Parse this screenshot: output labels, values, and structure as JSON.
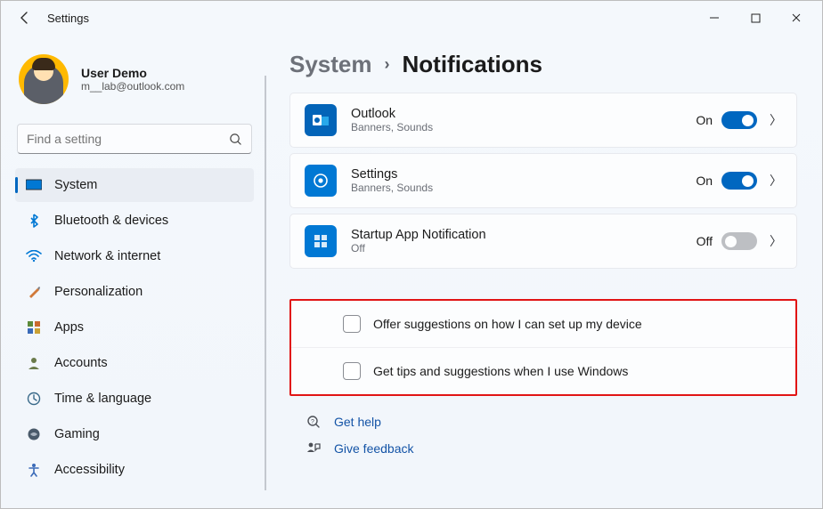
{
  "window": {
    "title": "Settings"
  },
  "profile": {
    "name": "User Demo",
    "email": "m__lab@outlook.com"
  },
  "search": {
    "placeholder": "Find a setting"
  },
  "sidebar": {
    "items": [
      {
        "label": "System",
        "icon": "system"
      },
      {
        "label": "Bluetooth & devices",
        "icon": "bluetooth"
      },
      {
        "label": "Network & internet",
        "icon": "wifi"
      },
      {
        "label": "Personalization",
        "icon": "brush"
      },
      {
        "label": "Apps",
        "icon": "apps"
      },
      {
        "label": "Accounts",
        "icon": "person"
      },
      {
        "label": "Time & language",
        "icon": "clock"
      },
      {
        "label": "Gaming",
        "icon": "gaming"
      },
      {
        "label": "Accessibility",
        "icon": "accessibility"
      }
    ]
  },
  "breadcrumb": {
    "parent": "System",
    "current": "Notifications"
  },
  "app_rows": [
    {
      "title": "Outlook",
      "subtitle": "Banners, Sounds",
      "state_label": "On",
      "state": "on",
      "icon": "outlook"
    },
    {
      "title": "Settings",
      "subtitle": "Banners, Sounds",
      "state_label": "On",
      "state": "on",
      "icon": "settings"
    },
    {
      "title": "Startup App Notification",
      "subtitle": "Off",
      "state_label": "Off",
      "state": "off",
      "icon": "startup"
    }
  ],
  "additional": {
    "option1": "Offer suggestions on how I can set up my device",
    "option2": "Get tips and suggestions when I use Windows"
  },
  "help": {
    "get_help": "Get help",
    "feedback": "Give feedback"
  }
}
